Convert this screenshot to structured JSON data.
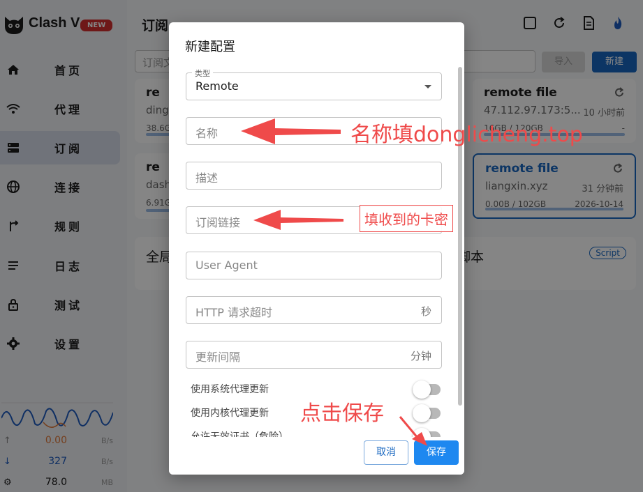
{
  "app": {
    "title": "Clash V",
    "badge": "NEW",
    "page_title": "订阅"
  },
  "sidebar": {
    "items": [
      {
        "label": "首页",
        "icon": "home-icon",
        "active": false
      },
      {
        "label": "代理",
        "icon": "wifi-icon",
        "active": false
      },
      {
        "label": "订阅",
        "icon": "storage-icon",
        "active": true
      },
      {
        "label": "连接",
        "icon": "globe-icon",
        "active": false
      },
      {
        "label": "规则",
        "icon": "fork-icon",
        "active": false
      },
      {
        "label": "日志",
        "icon": "list-icon",
        "active": false
      },
      {
        "label": "测试",
        "icon": "lock-icon",
        "active": false
      },
      {
        "label": "设置",
        "icon": "gear-icon",
        "active": false
      }
    ]
  },
  "traffic": {
    "up": {
      "value": "0.00",
      "unit": "B/s"
    },
    "down": {
      "value": "327",
      "unit": "B/s"
    },
    "mem": {
      "value": "78.0",
      "unit": "MB"
    }
  },
  "main": {
    "sub_input_placeholder": "订阅文",
    "import_label": "导入",
    "new_label": "新建",
    "cards": [
      {
        "name": "re",
        "host": "ding",
        "usage": "38.6G",
        "time": "",
        "date": ""
      },
      {
        "name": "re",
        "host": "dash",
        "usage": "6.91G",
        "time": "",
        "date": ""
      },
      {
        "name": "remote file",
        "host": "47.112.97.173:5...",
        "time": "10 小时前",
        "usage": "16GB / 120GB",
        "date": "-"
      },
      {
        "name": "remote file",
        "host": "liangxin.xyz",
        "time": "31 分钟前",
        "usage": "0.00B / 102GB",
        "date": "2026-10-14"
      }
    ],
    "global_title_left": "全局",
    "global_title_right": "脚本",
    "script_badge": "Script"
  },
  "dialog": {
    "title": "新建配置",
    "type_legend": "类型",
    "type_value": "Remote",
    "name_placeholder": "名称",
    "desc_placeholder": "描述",
    "url_placeholder": "订阅链接",
    "ua_placeholder": "User Agent",
    "timeout_placeholder": "HTTP 请求超时",
    "timeout_unit": "秒",
    "interval_placeholder": "更新间隔",
    "interval_unit": "分钟",
    "switches": [
      {
        "label": "使用系统代理更新",
        "on": false
      },
      {
        "label": "使用内核代理更新",
        "on": false
      },
      {
        "label": "允许无效证书（危险）",
        "on": false
      }
    ],
    "cancel_label": "取消",
    "save_label": "保存"
  },
  "annotations": {
    "name_hint": "名称填donglicheng.top",
    "url_hint": "填收到的卡密",
    "save_hint": "点击保存"
  },
  "colors": {
    "primary": "#1867c0",
    "annotation": "#ef4a4a",
    "badge": "#d32f2f"
  }
}
